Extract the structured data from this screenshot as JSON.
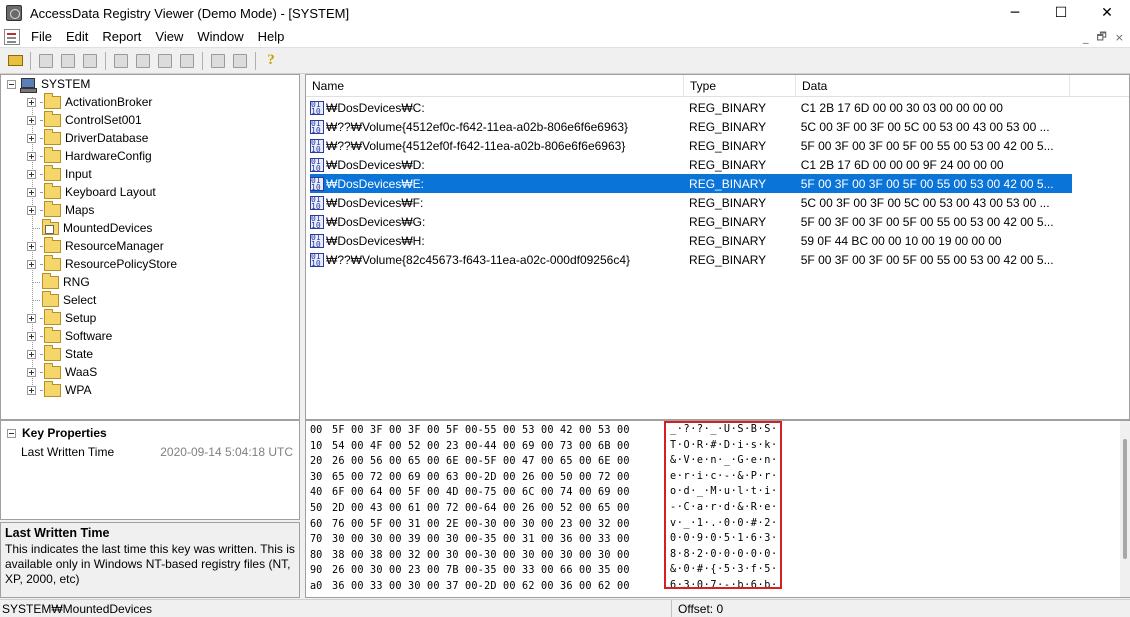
{
  "window": {
    "title": "AccessData Registry Viewer (Demo Mode) - [SYSTEM]",
    "minimize": "─",
    "maximize": "☐",
    "close": "✕"
  },
  "menu": {
    "items": [
      "File",
      "Edit",
      "Report",
      "View",
      "Window",
      "Help"
    ],
    "mdi_min": "_",
    "mdi_restore": "🗗",
    "mdi_close": "×"
  },
  "toolbar": {
    "help_glyph": "?"
  },
  "tree": {
    "root": "SYSTEM",
    "children": [
      {
        "label": "ActivationBroker",
        "expandable": true
      },
      {
        "label": "ControlSet001",
        "expandable": true
      },
      {
        "label": "DriverDatabase",
        "expandable": true
      },
      {
        "label": "HardwareConfig",
        "expandable": true
      },
      {
        "label": "Input",
        "expandable": true
      },
      {
        "label": "Keyboard Layout",
        "expandable": true
      },
      {
        "label": "Maps",
        "expandable": true
      },
      {
        "label": "MountedDevices",
        "expandable": false
      },
      {
        "label": "ResourceManager",
        "expandable": true
      },
      {
        "label": "ResourcePolicyStore",
        "expandable": true
      },
      {
        "label": "RNG",
        "expandable": false
      },
      {
        "label": "Select",
        "expandable": false
      },
      {
        "label": "Setup",
        "expandable": true
      },
      {
        "label": "Software",
        "expandable": true
      },
      {
        "label": "State",
        "expandable": true
      },
      {
        "label": "WaaS",
        "expandable": true
      },
      {
        "label": "WPA",
        "expandable": true
      }
    ]
  },
  "list": {
    "columns": [
      "Name",
      "Type",
      "Data"
    ],
    "rows": [
      {
        "name": "₩DosDevices₩C:",
        "type": "REG_BINARY",
        "data": "C1 2B 17 6D 00 00 30 03 00 00 00 00"
      },
      {
        "name": "₩??₩Volume{4512ef0c-f642-11ea-a02b-806e6f6e6963}",
        "type": "REG_BINARY",
        "data": "5C 00 3F 00 3F 00 5C 00 53 00 43 00 53 00 ..."
      },
      {
        "name": "₩??₩Volume{4512ef0f-f642-11ea-a02b-806e6f6e6963}",
        "type": "REG_BINARY",
        "data": "5F 00 3F 00 3F 00 5F 00 55 00 53 00 42 00 5..."
      },
      {
        "name": "₩DosDevices₩D:",
        "type": "REG_BINARY",
        "data": "C1 2B 17 6D 00 00 00 9F 24 00 00 00"
      },
      {
        "name": "₩DosDevices₩E:",
        "type": "REG_BINARY",
        "data": "5F 00 3F 00 3F 00 5F 00 55 00 53 00 42 00 5...",
        "selected": true
      },
      {
        "name": "₩DosDevices₩F:",
        "type": "REG_BINARY",
        "data": "5C 00 3F 00 3F 00 5C 00 53 00 43 00 53 00 ..."
      },
      {
        "name": "₩DosDevices₩G:",
        "type": "REG_BINARY",
        "data": "5F 00 3F 00 3F 00 5F 00 55 00 53 00 42 00 5..."
      },
      {
        "name": "₩DosDevices₩H:",
        "type": "REG_BINARY",
        "data": "59 0F 44 BC 00 00 10 00 19 00 00 00"
      },
      {
        "name": "₩??₩Volume{82c45673-f643-11ea-a02c-000df09256c4}",
        "type": "REG_BINARY",
        "data": "5F 00 3F 00 3F 00 5F 00 55 00 53 00 42 00 5..."
      }
    ]
  },
  "properties": {
    "header": "Key Properties",
    "label": "Last Written Time",
    "value": "2020-09-14 5:04:18 UTC"
  },
  "description": {
    "title": "Last Written Time",
    "text": "This indicates the last time this key was written. This is available only in Windows NT-based registry files (NT, XP, 2000, etc)"
  },
  "hex": {
    "rows": [
      {
        "offset": "00",
        "bytes": "5F 00 3F 00 3F 00 5F 00-55 00 53 00 42 00 53 00",
        "ascii": "_·?·?·_·U·S·B·S·"
      },
      {
        "offset": "10",
        "bytes": "54 00 4F 00 52 00 23 00-44 00 69 00 73 00 6B 00",
        "ascii": "T·O·R·#·D·i·s·k·"
      },
      {
        "offset": "20",
        "bytes": "26 00 56 00 65 00 6E 00-5F 00 47 00 65 00 6E 00",
        "ascii": "&·V·e·n·_·G·e·n·"
      },
      {
        "offset": "30",
        "bytes": "65 00 72 00 69 00 63 00-2D 00 26 00 50 00 72 00",
        "ascii": "e·r·i·c·-·&·P·r·"
      },
      {
        "offset": "40",
        "bytes": "6F 00 64 00 5F 00 4D 00-75 00 6C 00 74 00 69 00",
        "ascii": "o·d·_·M·u·l·t·i·"
      },
      {
        "offset": "50",
        "bytes": "2D 00 43 00 61 00 72 00-64 00 26 00 52 00 65 00",
        "ascii": "-·C·a·r·d·&·R·e·"
      },
      {
        "offset": "60",
        "bytes": "76 00 5F 00 31 00 2E 00-30 00 30 00 23 00 32 00",
        "ascii": "v·_·1·.·0·0·#·2·"
      },
      {
        "offset": "70",
        "bytes": "30 00 30 00 39 00 30 00-35 00 31 00 36 00 33 00",
        "ascii": "0·0·9·0·5·1·6·3·"
      },
      {
        "offset": "80",
        "bytes": "38 00 38 00 32 00 30 00-30 00 30 00 30 00 30 00",
        "ascii": "8·8·2·0·0·0·0·0·"
      },
      {
        "offset": "90",
        "bytes": "26 00 30 00 23 00 7B 00-35 00 33 00 66 00 35 00",
        "ascii": "&·0·#·{·5·3·f·5·"
      },
      {
        "offset": "a0",
        "bytes": "36 00 33 00 30 00 37 00-2D 00 62 00 36 00 62 00",
        "ascii": "6·3·0·7·-·b·6·b·"
      }
    ]
  },
  "status": {
    "path": "SYSTEM₩MountedDevices",
    "offset": "Offset: 0"
  },
  "colors": {
    "selection": "#0a74d9",
    "highlight_box": "#d42020"
  }
}
